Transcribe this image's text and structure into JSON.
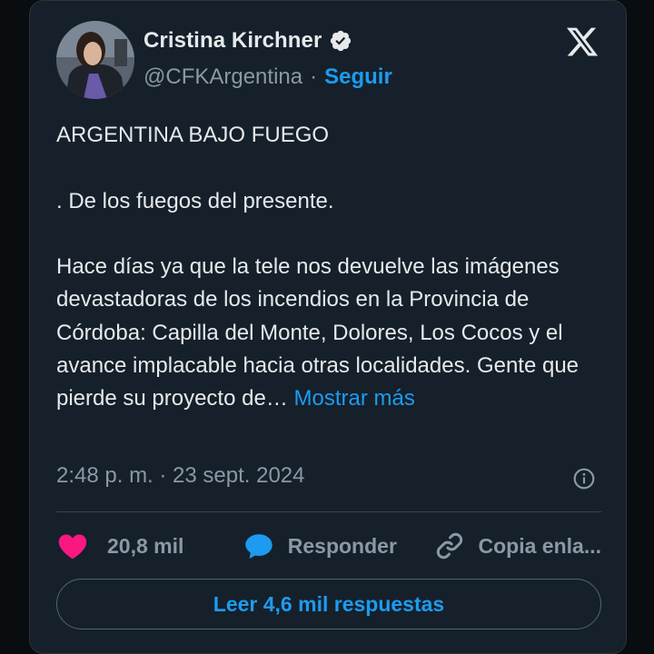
{
  "author": {
    "name": "Cristina Kirchner",
    "handle": "@CFKArgentina",
    "separator": "·",
    "follow_label": "Seguir"
  },
  "tweet": {
    "headline": "ARGENTINA BAJO FUEGO",
    "line2": ". De los fuegos del presente.",
    "body": "Hace días ya que la tele nos devuelve las imágenes devastadoras de los incendios en la Provincia de Córdoba: Capilla del Monte, Dolores, Los Cocos y el avance implacable hacia otras localidades. Gente que pierde su proyecto de…",
    "more_label": "Mostrar más"
  },
  "meta": {
    "timestamp": "2:48 p. m. · 23 sept. 2024"
  },
  "actions": {
    "like_count": "20,8 mil",
    "reply_label": "Responder",
    "copy_label": "Copia enla..."
  },
  "read_replies_label": "Leer 4,6 mil respuestas",
  "colors": {
    "background": "#15202b",
    "accent": "#1d9bf0",
    "like": "#f91880",
    "muted": "#8b98a5"
  },
  "icons": [
    "verified-badge-icon",
    "x-logo-icon",
    "info-icon",
    "heart-icon",
    "reply-bubble-icon",
    "link-icon"
  ]
}
